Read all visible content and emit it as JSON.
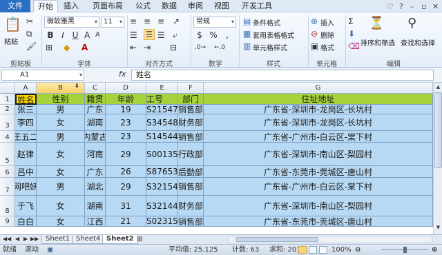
{
  "ribbon_tabs": [
    "文件",
    "开始",
    "插入",
    "页面布局",
    "公式",
    "数据",
    "审阅",
    "视图",
    "开发工具"
  ],
  "clipboard": {
    "paste": "粘贴",
    "group": "剪贴板"
  },
  "font": {
    "name": "微软雅黑",
    "size": "11",
    "bold": "B",
    "italic": "I",
    "underline": "U",
    "group": "字体"
  },
  "alignment": {
    "group": "对齐方式"
  },
  "number": {
    "format": "常规",
    "currency": "$",
    "percent": "%",
    "comma": ",",
    "group": "数字"
  },
  "styles": {
    "conditional": "条件格式",
    "table": "套用表格格式",
    "cell": "单元格样式",
    "group": "样式"
  },
  "cells": {
    "insert": "插入",
    "delete": "删除",
    "format": "格式",
    "group": "单元格"
  },
  "editing": {
    "sort": "排序和筛选",
    "find": "查找和选择",
    "group": "编辑"
  },
  "formula_bar": {
    "name_box": "A1",
    "fx": "fx",
    "value": "姓名"
  },
  "columns": [
    "A",
    "B",
    "C",
    "D",
    "E",
    "F",
    "G"
  ],
  "rows": [
    "1",
    "2",
    "3",
    "4",
    "5",
    "6",
    "7",
    "8",
    "9"
  ],
  "table": {
    "headers": [
      "姓名",
      "性别",
      "籍贯",
      "年龄",
      "工号",
      "部门",
      "住址地址"
    ],
    "records": [
      [
        "张三",
        "男",
        "广东",
        "19",
        "S21547",
        "销售部",
        "广东省-深圳市-龙岗区-长坑村"
      ],
      [
        "李四",
        "女",
        "湖南",
        "23",
        "S34548",
        "财务部",
        "广东省-深圳市-龙岗区-长坑村"
      ],
      [
        "王五二",
        "男",
        "内蒙古",
        "23",
        "S14544",
        "销售部",
        "广东省-广州市-白云区-棠下村"
      ],
      [
        "赵律",
        "女",
        "河南",
        "29",
        "S00135",
        "行政部",
        "广东省-深圳市-南山区-梨园村"
      ],
      [
        "吕中",
        "女",
        "广东",
        "26",
        "S87653",
        "后勤部",
        "广东省-东莞市-莞城区-唐山村"
      ],
      [
        "网吧妖",
        "男",
        "湖北",
        "29",
        "S32154",
        "销售部",
        "广东省-广州市-白云区-棠下村"
      ],
      [
        "于飞",
        "女",
        "湖南",
        "31",
        "S32144",
        "财务部",
        "广东省-深圳市-南山区-梨园村"
      ],
      [
        "白白",
        "女",
        "江西",
        "21",
        "S02315",
        "销售部",
        "广东省-东莞市-莞城区-唐山村"
      ]
    ]
  },
  "sheets": [
    "Sheet1",
    "Sheet4",
    "Sheet2"
  ],
  "active_sheet": "Sheet2",
  "status": {
    "mode": "就绪",
    "scroll": "滚动",
    "average": "平均值: 25.125",
    "count": "计数: 63",
    "sum": "求和: 201",
    "zoom": "100%"
  },
  "colors": {
    "header_fill": "#a6d33c",
    "body_fill": "#b8d9f3",
    "selected_fill": "#ffd800",
    "file_tab": "#2a6fc2"
  }
}
